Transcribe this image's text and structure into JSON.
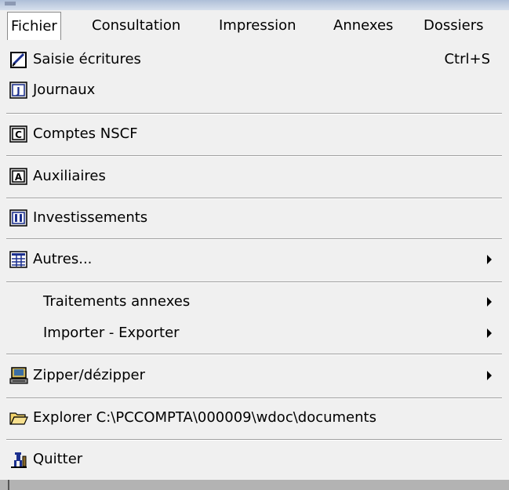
{
  "menubar": {
    "items": [
      {
        "label": "Fichier"
      },
      {
        "label": "Consultation"
      },
      {
        "label": "Impression"
      },
      {
        "label": "Annexes"
      },
      {
        "label": "Dossiers"
      }
    ]
  },
  "menu": {
    "saisie": {
      "label": "Saisie écritures",
      "shortcut": "Ctrl+S",
      "icon": "pencil-edit-icon"
    },
    "journaux": {
      "label": "Journaux",
      "icon": "journal-j-icon"
    },
    "comptes": {
      "label": "Comptes NSCF",
      "icon": "comptes-c-icon"
    },
    "auxiliaires": {
      "label": "Auxiliaires",
      "icon": "auxiliaires-a-icon"
    },
    "investissements": {
      "label": "Investissements",
      "icon": "investissements-i-icon"
    },
    "autres": {
      "label": "Autres...",
      "icon": "table-grid-icon"
    },
    "traitements": {
      "label": "Traitements annexes"
    },
    "importer": {
      "label": "Importer - Exporter"
    },
    "zipper": {
      "label": "Zipper/dézipper",
      "icon": "computer-zip-icon"
    },
    "explorer": {
      "label": "Explorer C:\\PCCOMPTA\\000009\\wdoc\\documents",
      "icon": "open-folder-icon"
    },
    "quitter": {
      "label": "Quitter",
      "icon": "exit-person-icon"
    }
  },
  "colors": {
    "menu_background": "#f0f0f0",
    "separator": "#a0a0a0",
    "active_menu_background": "#ffffff"
  }
}
